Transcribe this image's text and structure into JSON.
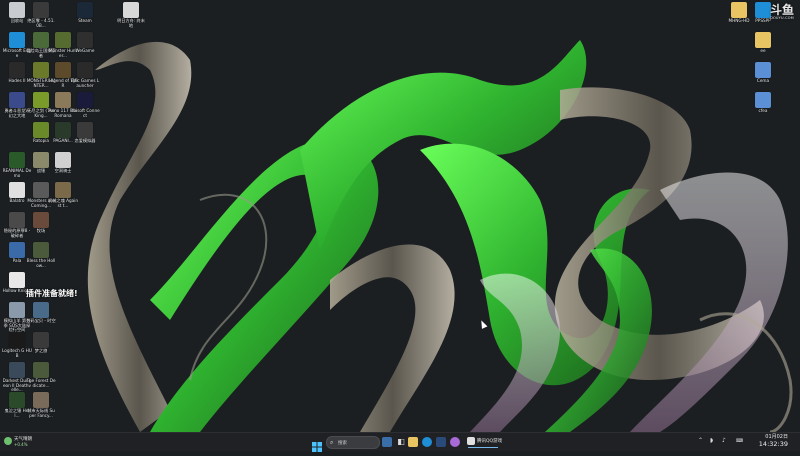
{
  "desktop": {
    "left_icons": [
      {
        "label": "回收站",
        "color": "#c8ccd0"
      },
      {
        "label": "绝区零 - 4.51.0B...",
        "color": "#3a3a3a"
      },
      {
        "label": "Steam",
        "color": "#1b2838"
      },
      {
        "label": "明日方舟: 终末地",
        "color": "#d8d8d8"
      },
      {
        "label": "Microsoft Edge",
        "color": "#1e8fd6"
      },
      {
        "label": "冒险岛王国探索者",
        "color": "#4a6a3a"
      },
      {
        "label": "Monster Hunter...",
        "color": "#556b2f"
      },
      {
        "label": "WeGame",
        "color": "#2f2f2f"
      },
      {
        "label": "Hades II",
        "color": "#2a2a2a"
      },
      {
        "label": "MONSTER HUNTER...",
        "color": "#6b7a2a"
      },
      {
        "label": "Legend of YMIR",
        "color": "#5c4a2a"
      },
      {
        "label": "Epic Games Launcher",
        "color": "#2a2a2a"
      },
      {
        "label": "勇者斗恶龙VI 幻之大地",
        "color": "#3a4a8a"
      },
      {
        "label": "无尽之剑 (The King...",
        "color": "#7a9a2a"
      },
      {
        "label": "Anno 117 Pax Romana",
        "color": "#8a7a5a"
      },
      {
        "label": "Ubisoft Connect",
        "color": "#1a1a3a"
      },
      {
        "label": "Ratopia",
        "color": "#6a8a2a"
      },
      {
        "label": "PAGANI...",
        "color": "#2a3a2a"
      },
      {
        "label": "恋爱模拟器",
        "color": "#3a3a3a"
      },
      {
        "label": "REANIMAL Demo",
        "color": "#2a5a2a"
      },
      {
        "label": "战锤",
        "color": "#8a8a6a"
      },
      {
        "label": "空洞骑士",
        "color": "#d0d0d0"
      },
      {
        "label": "Balatro",
        "color": "#e0e0e0"
      },
      {
        "label": "Monsters are Coming...",
        "color": "#5a5a5a"
      },
      {
        "label": "机械之魂 Against t...",
        "color": "#7a6a4a"
      },
      {
        "label": "隐秘的原罪8 - 破碎者",
        "color": "#4a4a4a"
      },
      {
        "label": "牧场",
        "color": "#6a4a3a"
      },
      {
        "label": "Pala",
        "color": "#3a6aa8"
      },
      {
        "label": "Bless the Hollow...",
        "color": "#4a5a3a"
      },
      {
        "label": "Hollow Knight",
        "color": "#e8e8e8"
      },
      {
        "label": "模拟山羊 第三季 SOS大陆探险行空间",
        "color": "#8a9aaa"
      },
      {
        "label": "数码宝贝 - 时空",
        "color": "#4a6a8a"
      },
      {
        "label": "Logitech G HUB",
        "color": "#1a1a1a"
      },
      {
        "label": "梦之旅",
        "color": "#3a3a3a"
      },
      {
        "label": "Darkest Dungeon II Deathvelle...",
        "color": "#3a4a5a"
      },
      {
        "label": "The Forest Dedicate...",
        "color": "#4a5a3a"
      },
      {
        "label": "鬼泣之锤 Hell...",
        "color": "#2a4a2a"
      },
      {
        "label": "城市天际线 Super Fancy...",
        "color": "#7a6a5a"
      }
    ],
    "right_icons": [
      {
        "label": "MHNG-HD",
        "color": "#e8c463"
      },
      {
        "label": "PPSSPP",
        "color": "#1e8fd6"
      },
      {
        "label": "ee",
        "color": "#e8c463"
      },
      {
        "label": "Cema",
        "color": "#5b8fd6"
      },
      {
        "label": "cfea",
        "color": "#5b8fd6"
      }
    ],
    "overlay_text": "插件准备就绪!",
    "watermark": {
      "main": "斗鱼",
      "sub": "DOUYU.COM"
    }
  },
  "taskbar": {
    "weather": {
      "text": "天气晴朗",
      "temp": "+0.4%"
    },
    "search_placeholder": "搜索",
    "active_app": "腾讯QQ游戏",
    "clock": {
      "date": "01月02日",
      "time": "14:32:39"
    }
  },
  "colors": {
    "ribbon_green": "#3fd33f",
    "wallpaper_bg": "#1b1f22",
    "taskbar_bg": "#202124",
    "accent": "#76b9ed"
  }
}
